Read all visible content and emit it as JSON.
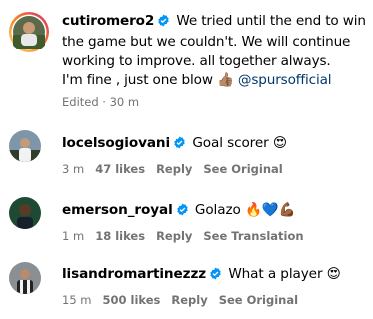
{
  "post": {
    "username": "cutiromero2",
    "caption_line1": "We tried until the end to win the game but we couldn't. We will continue working to improve. all together always.",
    "caption_line2": "I'm fine , just one blow",
    "caption_emoji": "👍🏽",
    "mention": "@spursofficial",
    "edited": "Edited · 30 m"
  },
  "comments": [
    {
      "username": "locelsogiovani",
      "text": "Goal scorer",
      "emoji": "😍",
      "time": "3 m",
      "likes": "47 likes",
      "reply": "Reply",
      "translate": "See Original"
    },
    {
      "username": "emerson_royal",
      "text": "Golazo",
      "emoji": "🔥💙💪🏾",
      "time": "1 m",
      "likes": "18 likes",
      "reply": "Reply",
      "translate": "See Translation"
    },
    {
      "username": "lisandromartinezzz",
      "text": "What a player",
      "emoji": "😍",
      "time": "15 m",
      "likes": "500 likes",
      "reply": "Reply",
      "translate": "See Original"
    }
  ],
  "colors": {
    "verified": "#0095f6",
    "mention": "#00376b",
    "meta": "#737373",
    "story_ring_start": "#feda75",
    "story_ring_end": "#d62976"
  },
  "icons": [
    "verified-badge-icon"
  ]
}
